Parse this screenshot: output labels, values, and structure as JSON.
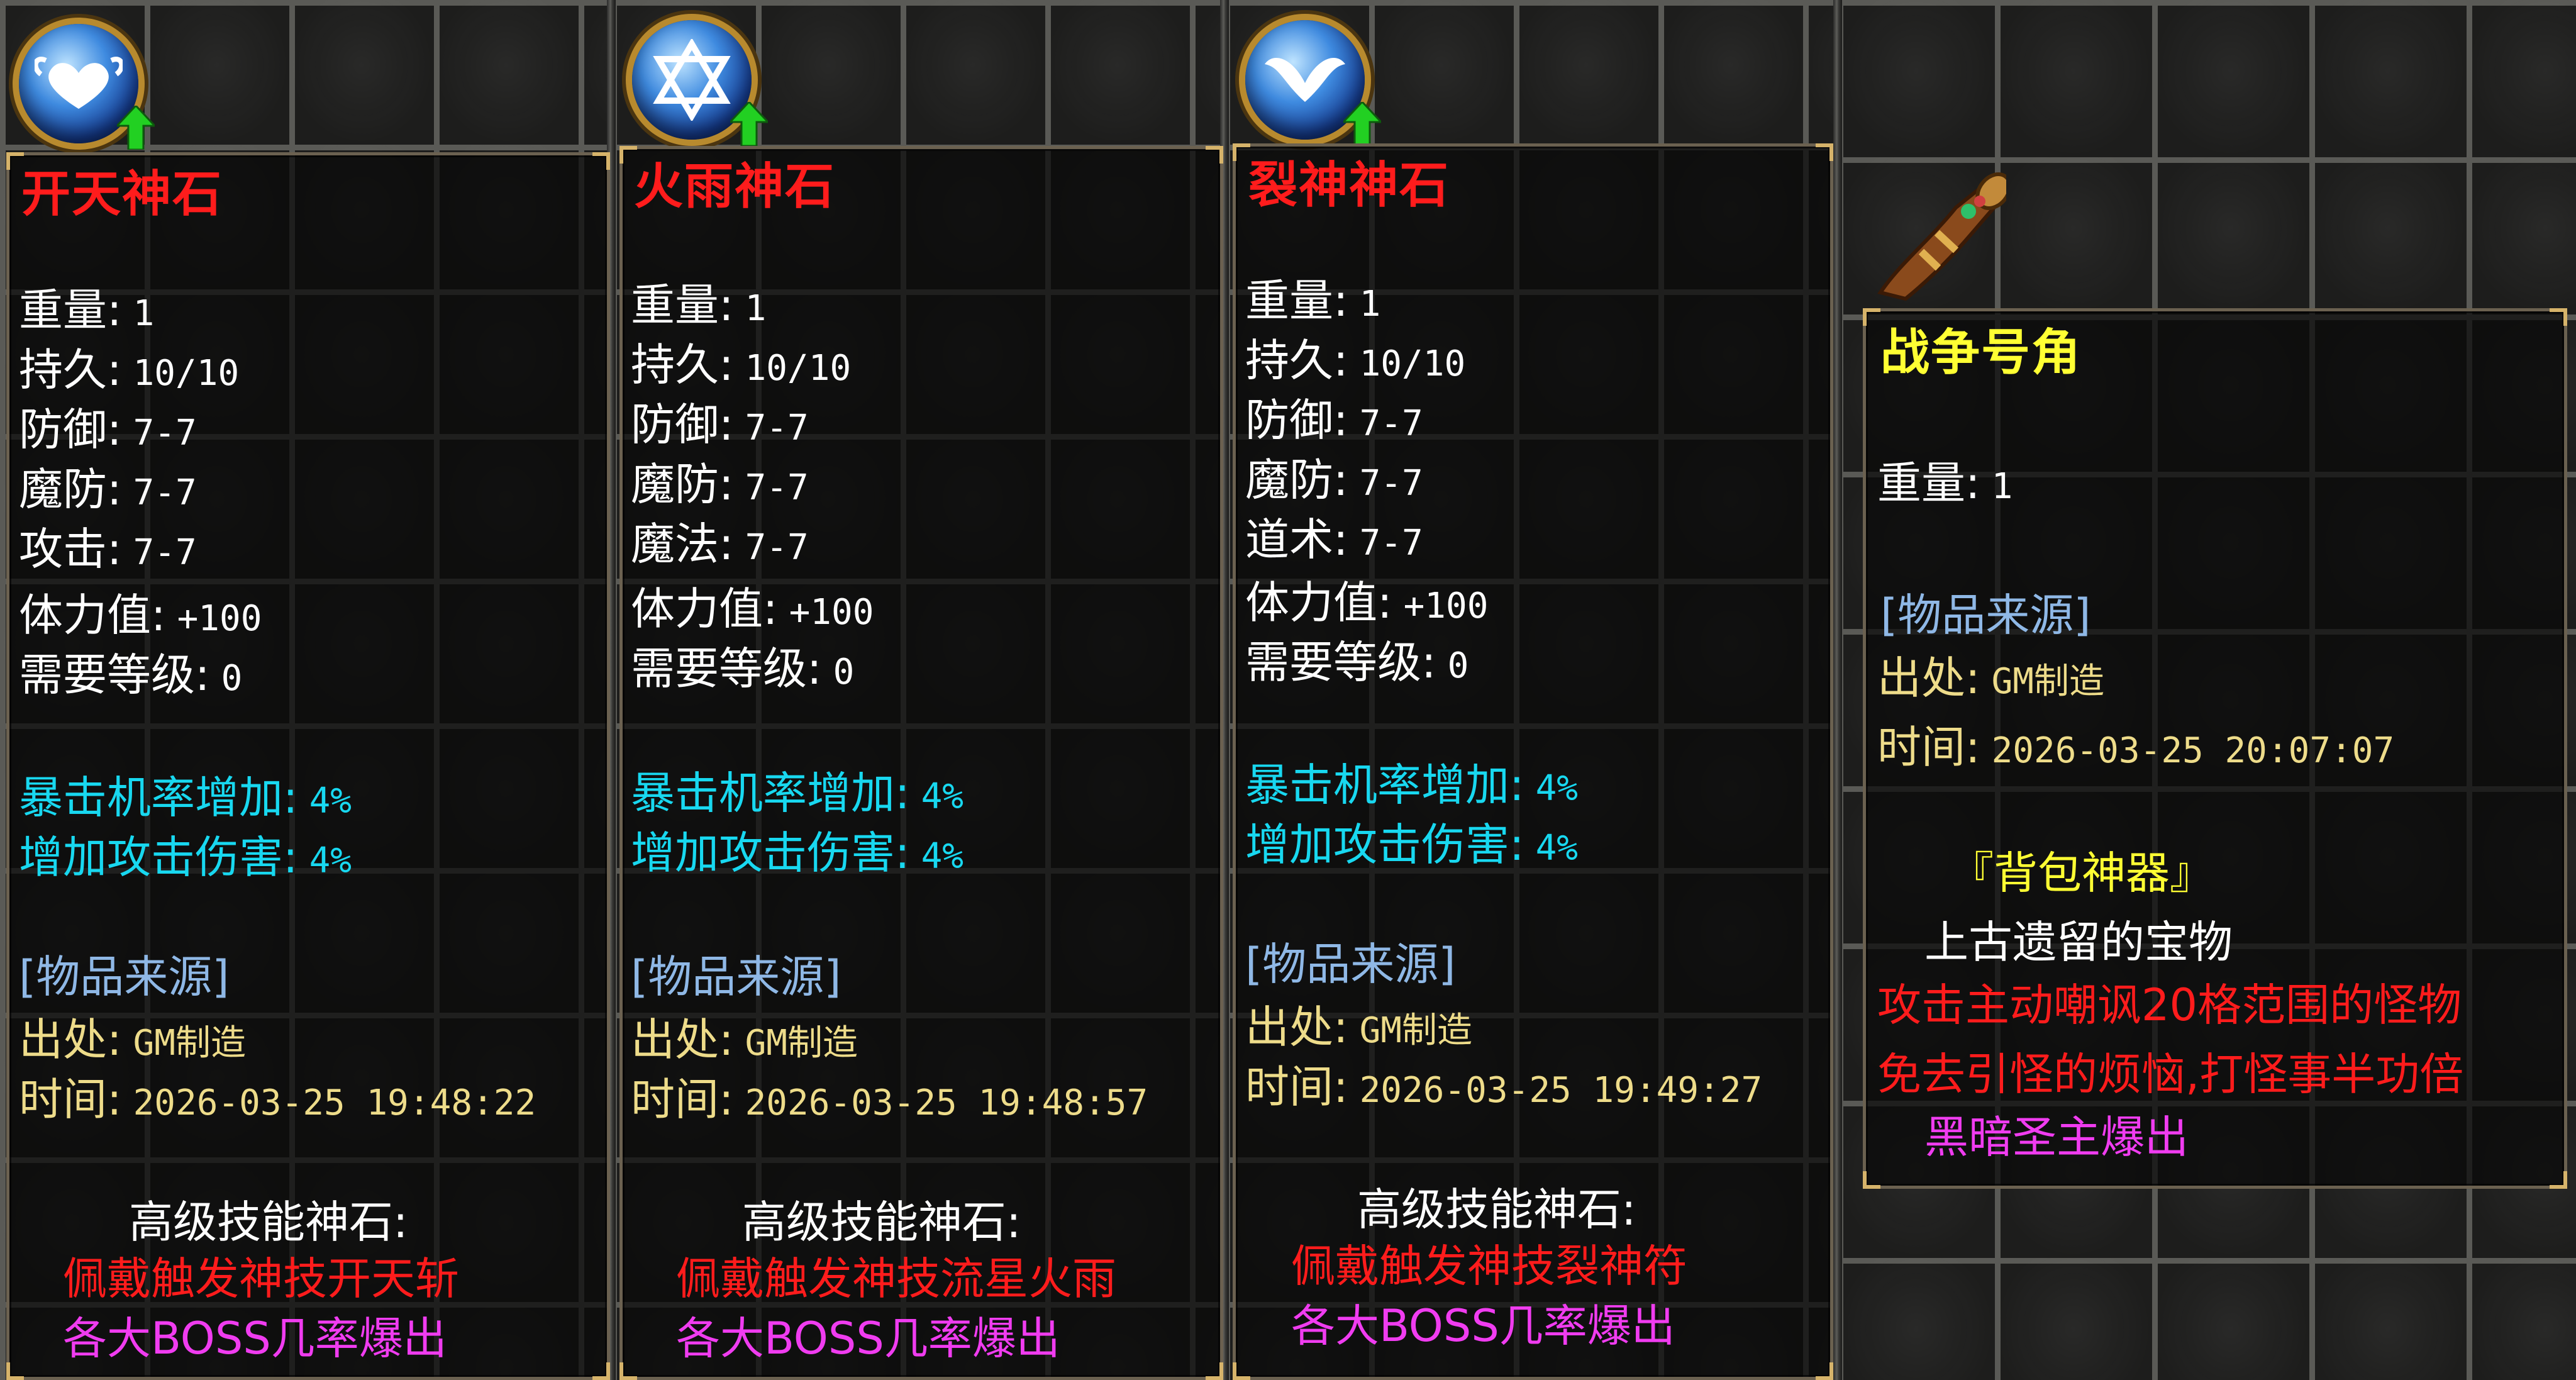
{
  "cards": [
    {
      "name": "开天神石",
      "stats": [
        {
          "label": "重量:",
          "value": "1"
        },
        {
          "label": "持久:",
          "value": "10/10"
        },
        {
          "label": "防御:",
          "value": "7-7"
        },
        {
          "label": "魔防:",
          "value": "7-7"
        },
        {
          "label": "攻击:",
          "value": "7-7"
        },
        {
          "label": "体力值:",
          "value": "+100"
        },
        {
          "label": "需要等级:",
          "value": "0"
        }
      ],
      "bonuses": [
        {
          "label": "暴击机率增加:",
          "value": "4%"
        },
        {
          "label": "增加攻击伤害:",
          "value": "4%"
        }
      ],
      "source_header": "[物品来源]",
      "origin": {
        "label": "出处:",
        "value": "GM制造"
      },
      "time": {
        "label": "时间:",
        "value": "2026-03-25 19:48:22"
      },
      "skill_title": "高级技能神石:",
      "skill_desc": "佩戴触发神技开天斩",
      "drop": "各大BOSS几率爆出"
    },
    {
      "name": "火雨神石",
      "stats": [
        {
          "label": "重量:",
          "value": "1"
        },
        {
          "label": "持久:",
          "value": "10/10"
        },
        {
          "label": "防御:",
          "value": "7-7"
        },
        {
          "label": "魔防:",
          "value": "7-7"
        },
        {
          "label": "魔法:",
          "value": "7-7"
        },
        {
          "label": "体力值:",
          "value": "+100"
        },
        {
          "label": "需要等级:",
          "value": "0"
        }
      ],
      "bonuses": [
        {
          "label": "暴击机率增加:",
          "value": "4%"
        },
        {
          "label": "增加攻击伤害:",
          "value": "4%"
        }
      ],
      "source_header": "[物品来源]",
      "origin": {
        "label": "出处:",
        "value": "GM制造"
      },
      "time": {
        "label": "时间:",
        "value": "2026-03-25 19:48:57"
      },
      "skill_title": "高级技能神石:",
      "skill_desc": "佩戴触发神技流星火雨",
      "drop": "各大BOSS几率爆出"
    },
    {
      "name": "裂神神石",
      "stats": [
        {
          "label": "重量:",
          "value": "1"
        },
        {
          "label": "持久:",
          "value": "10/10"
        },
        {
          "label": "防御:",
          "value": "7-7"
        },
        {
          "label": "魔防:",
          "value": "7-7"
        },
        {
          "label": "道术:",
          "value": "7-7"
        },
        {
          "label": "体力值:",
          "value": "+100"
        },
        {
          "label": "需要等级:",
          "value": "0"
        }
      ],
      "bonuses": [
        {
          "label": "暴击机率增加:",
          "value": "4%"
        },
        {
          "label": "增加攻击伤害:",
          "value": "4%"
        }
      ],
      "source_header": "[物品来源]",
      "origin": {
        "label": "出处:",
        "value": "GM制造"
      },
      "time": {
        "label": "时间:",
        "value": "2026-03-25 19:49:27"
      },
      "skill_title": "高级技能神石:",
      "skill_desc": "佩戴触发神技裂神符",
      "drop": "各大BOSS几率爆出"
    }
  ],
  "horn_card": {
    "name": "战争号角",
    "weight": {
      "label": "重量:",
      "value": "1"
    },
    "source_header": "[物品来源]",
    "origin": {
      "label": "出处:",
      "value": "GM制造"
    },
    "time": {
      "label": "时间:",
      "value": "2026-03-25 20:07:07"
    },
    "tag": "『背包神器』",
    "flavor": "上古遗留的宝物",
    "effect_line1": "攻击主动嘲讽20格范围的怪物",
    "effect_line2": "免去引怪的烦恼,打怪事半功倍",
    "drop": "黑暗圣主爆出"
  },
  "icons": {
    "card1": "heart-wings-orb-icon",
    "card2": "star-of-david-orb-icon",
    "card3": "wings-orb-icon",
    "horn": "war-horn-icon",
    "upgrade": "green-up-arrow-icon"
  },
  "colors": {
    "item_name": "#ff1c1c",
    "horn_name": "#ffff33",
    "bonus": "#18d8f0",
    "source": "#8fb8e6",
    "origin": "#eedc8a",
    "drop": "#f03cf0"
  }
}
